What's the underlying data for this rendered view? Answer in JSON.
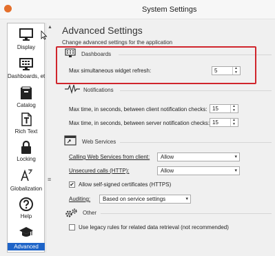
{
  "window": {
    "title": "System Settings",
    "icon": "app-logo-icon"
  },
  "sidebar": {
    "items": [
      {
        "label": "Display",
        "icon": "monitor-icon",
        "selected": false
      },
      {
        "label": "Dashboards, etc.",
        "icon": "dashboard-icon",
        "selected": false
      },
      {
        "label": "Catalog",
        "icon": "catalog-icon",
        "selected": false
      },
      {
        "label": "Rich Text",
        "icon": "rich-text-icon",
        "selected": false
      },
      {
        "label": "Locking",
        "icon": "lock-icon",
        "selected": false
      },
      {
        "label": "Globalization",
        "icon": "globalization-icon",
        "selected": false
      },
      {
        "label": "Help",
        "icon": "help-icon",
        "selected": false
      },
      {
        "label": "Advanced",
        "icon": "graduation-cap-icon",
        "selected": true
      }
    ]
  },
  "main": {
    "title": "Advanced Settings",
    "subtitle": "Change advanced settings for the application",
    "dashboards": {
      "title": "Dashboards",
      "refresh_label": "Max simultaneous widget refresh:",
      "refresh_value": "5"
    },
    "notifications": {
      "title": "Notifications",
      "client_label": "Max time, in seconds, between client notification checks:",
      "client_value": "15",
      "server_label": "Max time, in seconds, between server notification checks:",
      "server_value": "15"
    },
    "web_services": {
      "title": "Web Services",
      "calling_label": "Calling Web Services from client:",
      "calling_value": "Allow",
      "unsecured_label": "Unsecured calls (HTTP):",
      "unsecured_value": "Allow",
      "self_signed_label": "Allow self-signed certificates (HTTPS)",
      "self_signed_checked": true,
      "auditing_label": "Auditing:",
      "auditing_value": "Based on service settings"
    },
    "other": {
      "title": "Other",
      "legacy_label": "Use legacy rules for related data retrieval (not recommended)",
      "legacy_checked": false
    }
  },
  "colors": {
    "selected_bg": "#1e64c8",
    "highlight_border": "#d0242b",
    "app_icon": "#e46f2b"
  }
}
